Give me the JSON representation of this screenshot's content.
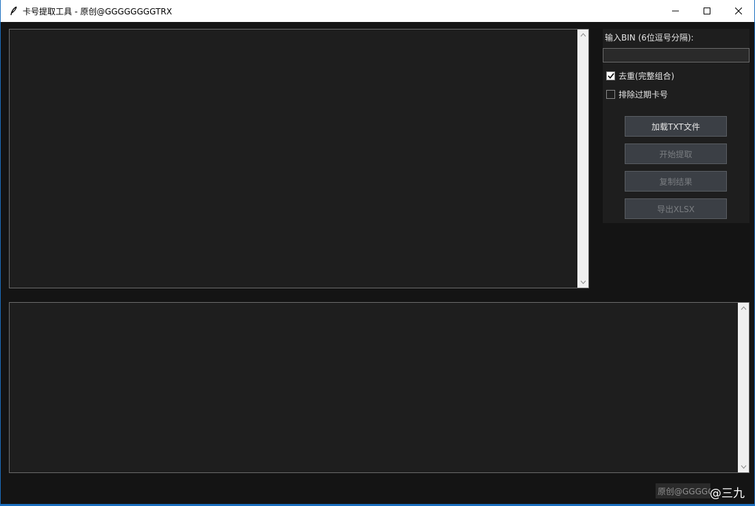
{
  "window": {
    "title": "卡号提取工具 - 原创@GGGGGGGGTRX",
    "app_icon": "feather-icon",
    "controls": [
      "minimize-icon",
      "maximize-icon",
      "close-icon"
    ]
  },
  "panel": {
    "bin_label": "输入BIN (6位逗号分隔):",
    "bin_value": "",
    "checkboxes": [
      {
        "label": "去重(完整组合)",
        "checked": true
      },
      {
        "label": "排除过期卡号",
        "checked": false
      }
    ],
    "buttons": [
      {
        "label": "加载TXT文件",
        "enabled": true
      },
      {
        "label": "开始提取",
        "enabled": false
      },
      {
        "label": "复制结果",
        "enabled": false
      },
      {
        "label": "导出XLSX",
        "enabled": false
      }
    ]
  },
  "input_text": "",
  "output_text": "",
  "footer": {
    "credit": "原创@GGGGGGGGTRX",
    "watermark": "@三九"
  },
  "colors": {
    "accent": "#1b6fc0",
    "background": "#141414",
    "textbox_bg": "#1e1e1e",
    "button_bg": "#3b3f45"
  }
}
